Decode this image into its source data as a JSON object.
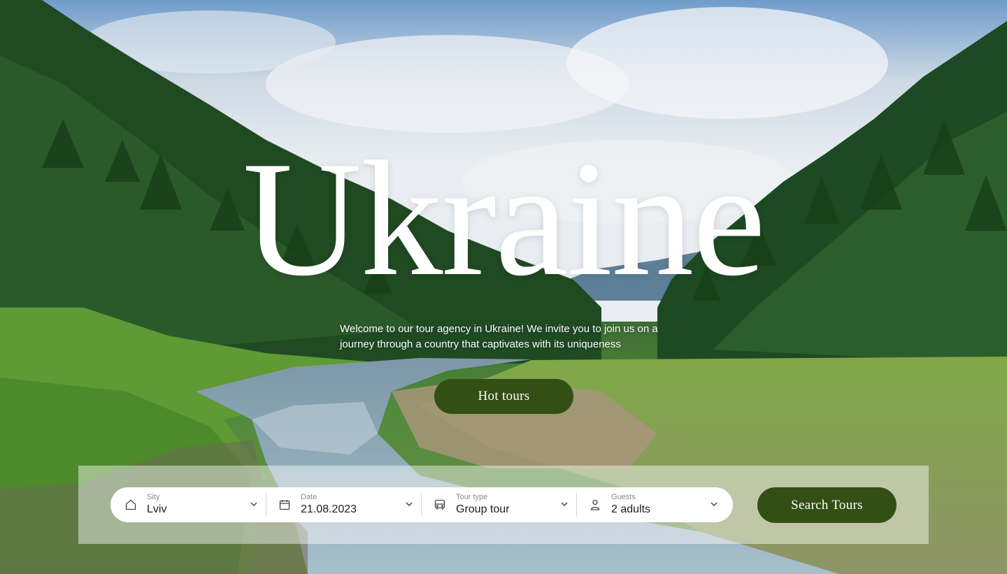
{
  "hero": {
    "title": "Ukraine",
    "welcome_text": "Welcome to our tour agency in Ukraine! We invite you to join us on a journey through a country that captivates with its uniqueness",
    "hot_tours_label": "Hot tours"
  },
  "search": {
    "fields": [
      {
        "label": "Sity",
        "value": "Lviv",
        "icon": "home-icon"
      },
      {
        "label": "Date",
        "value": "21.08.2023",
        "icon": "calendar-icon"
      },
      {
        "label": "Tour type",
        "value": "Group tour",
        "icon": "bus-icon"
      },
      {
        "label": "Guests",
        "value": "2 adults",
        "icon": "person-icon"
      }
    ],
    "button_label": "Search Tours"
  },
  "colors": {
    "primary": "#334f14",
    "panel": "#ffffff"
  }
}
